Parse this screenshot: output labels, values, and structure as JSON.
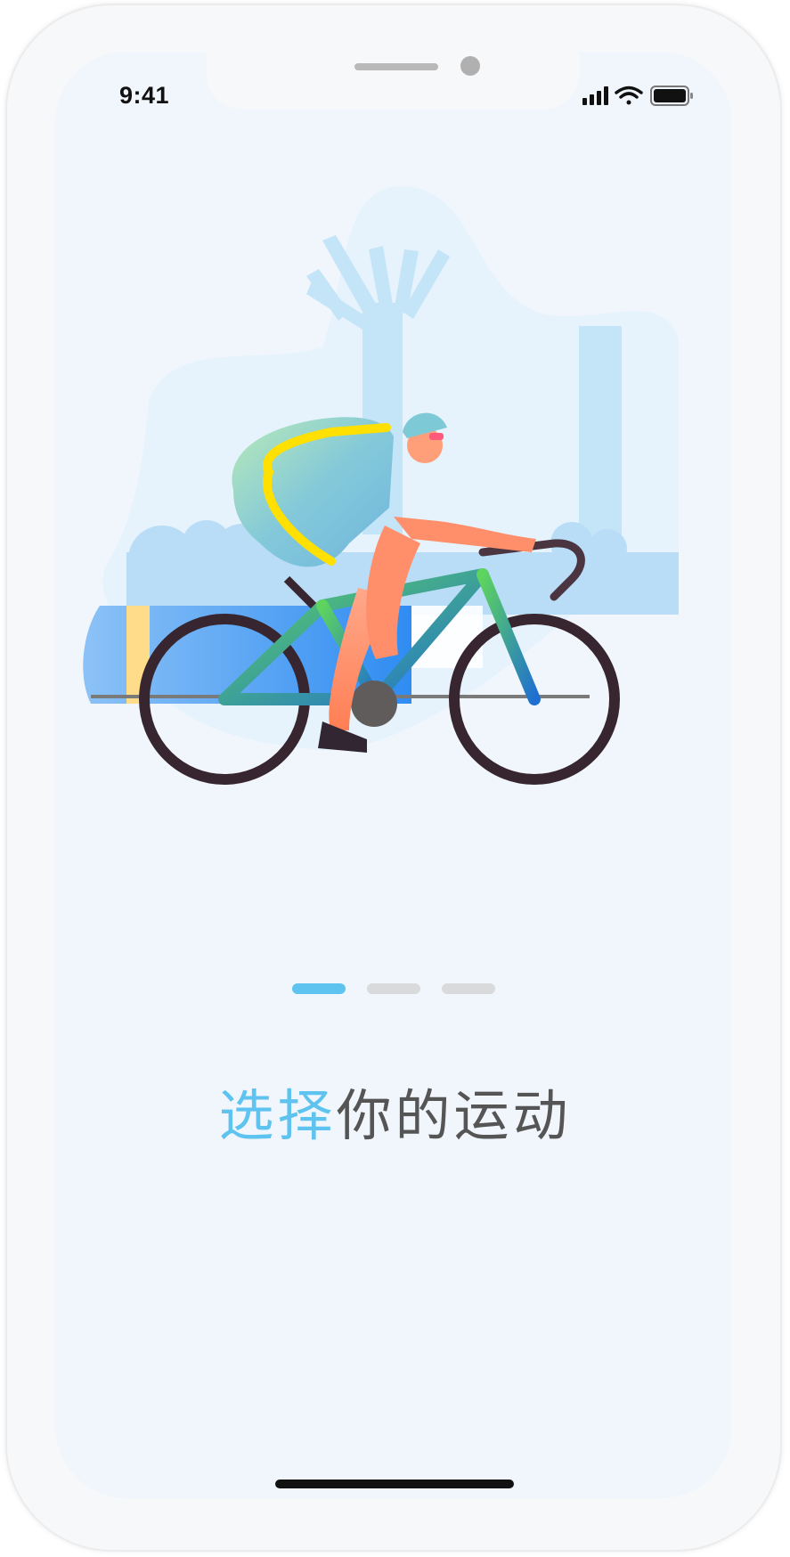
{
  "status_bar": {
    "time": "9:41",
    "icons": [
      "signal-icon",
      "wifi-icon",
      "battery-icon"
    ]
  },
  "onboarding": {
    "illustration": "cyclist-illustration",
    "pager": {
      "total": 3,
      "active_index": 0
    },
    "headline_accent": "选择",
    "headline_rest": "你的运动"
  },
  "colors": {
    "accent": "#5ec3ef",
    "text": "#555555",
    "screen_background": "#f1f6fd",
    "pager_inactive": "#d9dadc"
  }
}
